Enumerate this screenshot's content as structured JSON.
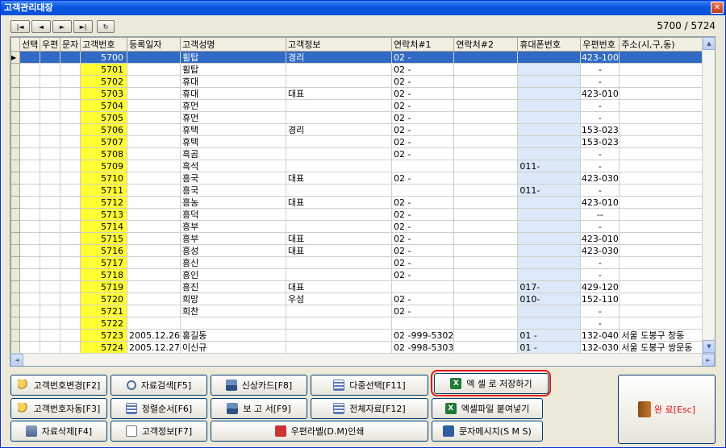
{
  "window": {
    "title": "고객관리대장",
    "close_glyph": "✕"
  },
  "nav": {
    "first": "|◄",
    "prev": "◄",
    "next": "►",
    "last": "►|",
    "refresh": "↻"
  },
  "record_counter": "5700 / 5724",
  "grid": {
    "columns": [
      "선택",
      "우편",
      "문자",
      "고객번호",
      "등록일자",
      "고객성명",
      "고객정보",
      "연락처#1",
      "연락처#2",
      "휴대폰번호",
      "우편번호",
      "주소(시,구,동)"
    ],
    "rows": [
      {
        "no": "5700",
        "date": "",
        "name": "휠탑",
        "info": "경리",
        "tel1": "02  -",
        "tel2": "",
        "mobile": "",
        "zip": "423-100",
        "addr": "",
        "selected": true
      },
      {
        "no": "5701",
        "date": "",
        "name": "휠탑",
        "info": "",
        "tel1": "02  -",
        "tel2": "",
        "mobile": "",
        "zip": "-",
        "addr": ""
      },
      {
        "no": "5702",
        "date": "",
        "name": "휴대",
        "info": "",
        "tel1": "02  -",
        "tel2": "",
        "mobile": "",
        "zip": "-",
        "addr": ""
      },
      {
        "no": "5703",
        "date": "",
        "name": "휴대",
        "info": "대표",
        "tel1": "02  -",
        "tel2": "",
        "mobile": "",
        "zip": "423-010",
        "addr": ""
      },
      {
        "no": "5704",
        "date": "",
        "name": "휴먼",
        "info": "",
        "tel1": "02  -",
        "tel2": "",
        "mobile": "",
        "zip": "-",
        "addr": ""
      },
      {
        "no": "5705",
        "date": "",
        "name": "휴먼",
        "info": "",
        "tel1": "02  -",
        "tel2": "",
        "mobile": "",
        "zip": "-",
        "addr": ""
      },
      {
        "no": "5706",
        "date": "",
        "name": "휴택",
        "info": "경리",
        "tel1": "02  -",
        "tel2": "",
        "mobile": "",
        "zip": "153-023",
        "addr": ""
      },
      {
        "no": "5707",
        "date": "",
        "name": "휴텍",
        "info": "",
        "tel1": "02  -",
        "tel2": "",
        "mobile": "",
        "zip": "153-023",
        "addr": ""
      },
      {
        "no": "5708",
        "date": "",
        "name": "흑곰",
        "info": "",
        "tel1": "02  -",
        "tel2": "",
        "mobile": "",
        "zip": "-",
        "addr": ""
      },
      {
        "no": "5709",
        "date": "",
        "name": "흑석",
        "info": "",
        "tel1": "",
        "tel2": "",
        "mobile": "011-",
        "zip": "-",
        "addr": ""
      },
      {
        "no": "5710",
        "date": "",
        "name": "흥국",
        "info": "대표",
        "tel1": "02  -",
        "tel2": "",
        "mobile": "",
        "zip": "423-030",
        "addr": ""
      },
      {
        "no": "5711",
        "date": "",
        "name": "흥국",
        "info": "",
        "tel1": "",
        "tel2": "",
        "mobile": "011-",
        "zip": "-",
        "addr": ""
      },
      {
        "no": "5712",
        "date": "",
        "name": "흥농",
        "info": "대표",
        "tel1": "02  -",
        "tel2": "",
        "mobile": "",
        "zip": "423-010",
        "addr": ""
      },
      {
        "no": "5713",
        "date": "",
        "name": "흥덕",
        "info": "",
        "tel1": "02  -",
        "tel2": "",
        "mobile": "",
        "zip": "--",
        "addr": ""
      },
      {
        "no": "5714",
        "date": "",
        "name": "흥부",
        "info": "",
        "tel1": "02  -",
        "tel2": "",
        "mobile": "",
        "zip": "-",
        "addr": ""
      },
      {
        "no": "5715",
        "date": "",
        "name": "흥부",
        "info": "대표",
        "tel1": "02  -",
        "tel2": "",
        "mobile": "",
        "zip": "423-010",
        "addr": ""
      },
      {
        "no": "5716",
        "date": "",
        "name": "흥성",
        "info": "대표",
        "tel1": "02  -",
        "tel2": "",
        "mobile": "",
        "zip": "423-030",
        "addr": ""
      },
      {
        "no": "5717",
        "date": "",
        "name": "흥신",
        "info": "",
        "tel1": "02  -",
        "tel2": "",
        "mobile": "",
        "zip": "-",
        "addr": ""
      },
      {
        "no": "5718",
        "date": "",
        "name": "흥인",
        "info": "",
        "tel1": "02  -",
        "tel2": "",
        "mobile": "",
        "zip": "-",
        "addr": ""
      },
      {
        "no": "5719",
        "date": "",
        "name": "흥진",
        "info": "대표",
        "tel1": "",
        "tel2": "",
        "mobile": "017-",
        "zip": "429-120",
        "addr": ""
      },
      {
        "no": "5720",
        "date": "",
        "name": "희망",
        "info": "우성",
        "tel1": "02  -",
        "tel2": "",
        "mobile": "010-",
        "zip": "152-110",
        "addr": ""
      },
      {
        "no": "5721",
        "date": "",
        "name": "희찬",
        "info": "",
        "tel1": "02  -",
        "tel2": "",
        "mobile": "",
        "zip": "-",
        "addr": ""
      },
      {
        "no": "5722",
        "date": "",
        "name": "",
        "info": "",
        "tel1": "",
        "tel2": "",
        "mobile": "",
        "zip": "-",
        "addr": ""
      },
      {
        "no": "5723",
        "date": "2005.12.26",
        "name": "홍길동",
        "info": "",
        "tel1": "02  -999-5302",
        "tel2": "",
        "mobile": "01  -",
        "zip": "132-040",
        "addr": "서울 도봉구 창동"
      },
      {
        "no": "5724",
        "date": "2005.12.27",
        "name": "이신규",
        "info": "",
        "tel1": "02  -998-5303",
        "tel2": "",
        "mobile": "01  -",
        "zip": "132-030",
        "addr": "서울 도봉구 쌍문동"
      }
    ]
  },
  "buttons": {
    "change_no": "고객번호변경[F2]",
    "auto_no": "고객번호자동[F3]",
    "delete": "자료삭제[F4]",
    "search": "자료검색[F5]",
    "sort": "정렬순서[F6]",
    "info": "고객정보[F7]",
    "new_card": "신상카드[F8]",
    "report": "보 고 서[F9]",
    "label_print": "우편라벨(D.M)인쇄",
    "multi_select": "다중선택[F11]",
    "all_data": "전체자료[F12]",
    "sms": "문자메시지(S M S)",
    "excel_save": "엑 셀 로 저장하기",
    "excel_paste": "엑셀파일 붙여넣기",
    "done": "완 료[Esc]"
  },
  "colors": {
    "title_bar": "#0a58e0",
    "selection": "#316ac5",
    "number_cell": "#ffff33",
    "mobile_cell": "#dce9f8",
    "highlight_ring": "#e11414"
  }
}
